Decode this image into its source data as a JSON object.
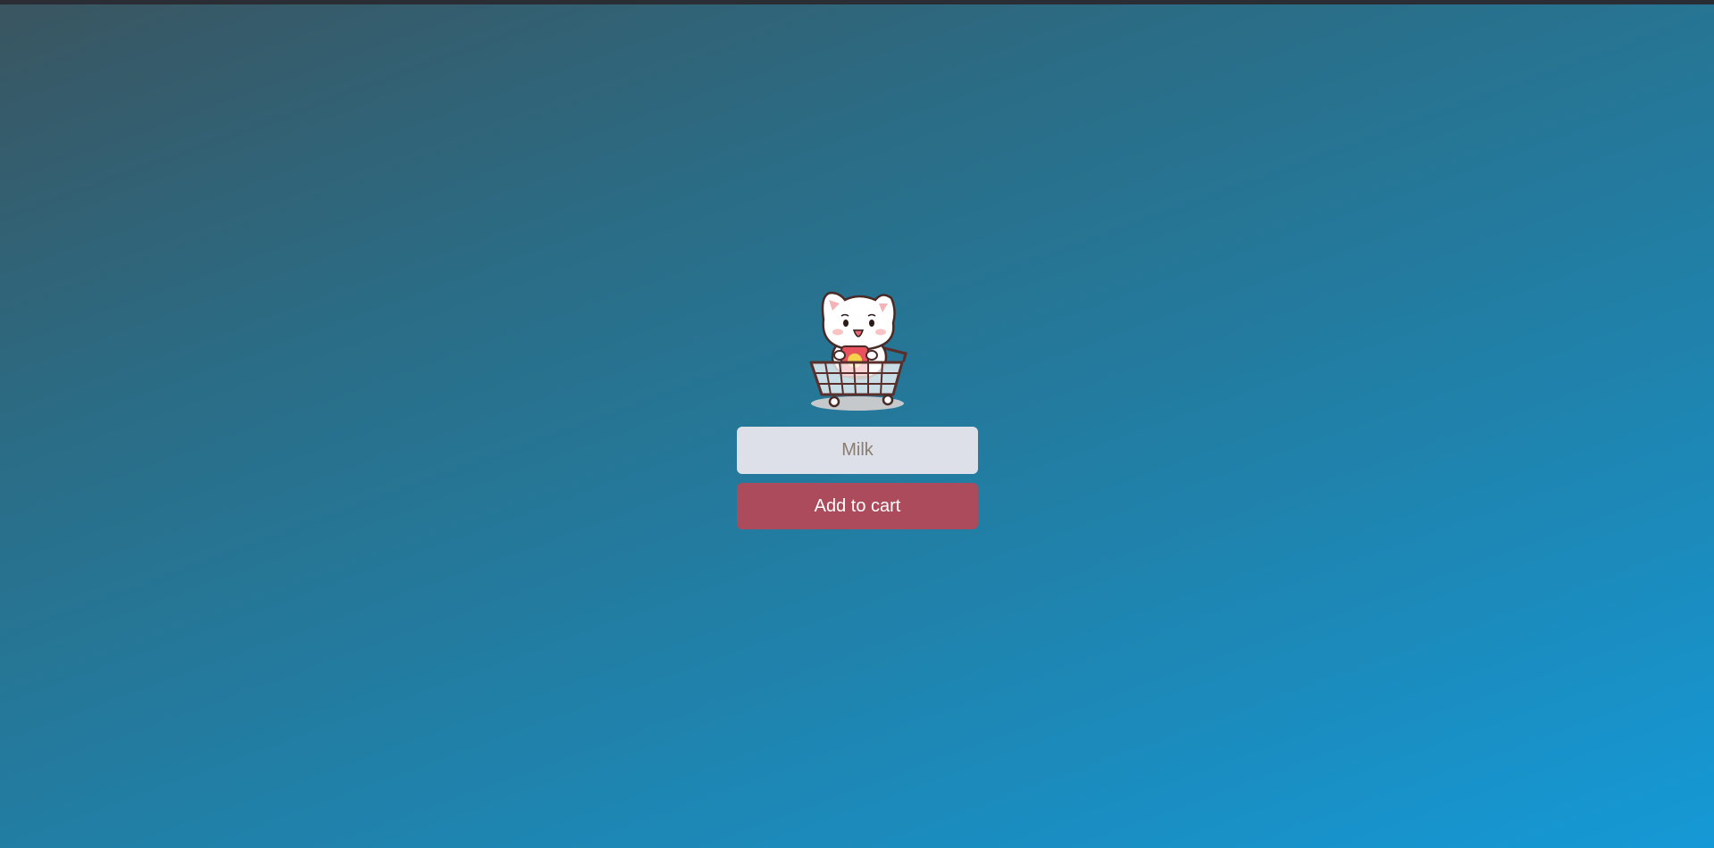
{
  "cart_form": {
    "mascot_icon": "cat-in-shopping-cart-icon",
    "item_input": {
      "value": "",
      "placeholder": "Milk"
    },
    "add_button_label": "Add to cart"
  },
  "colors": {
    "button": "#ab4b5c",
    "input_bg": "#dde0e8",
    "bg_start": "#3a5560",
    "bg_end": "#1599d6"
  }
}
